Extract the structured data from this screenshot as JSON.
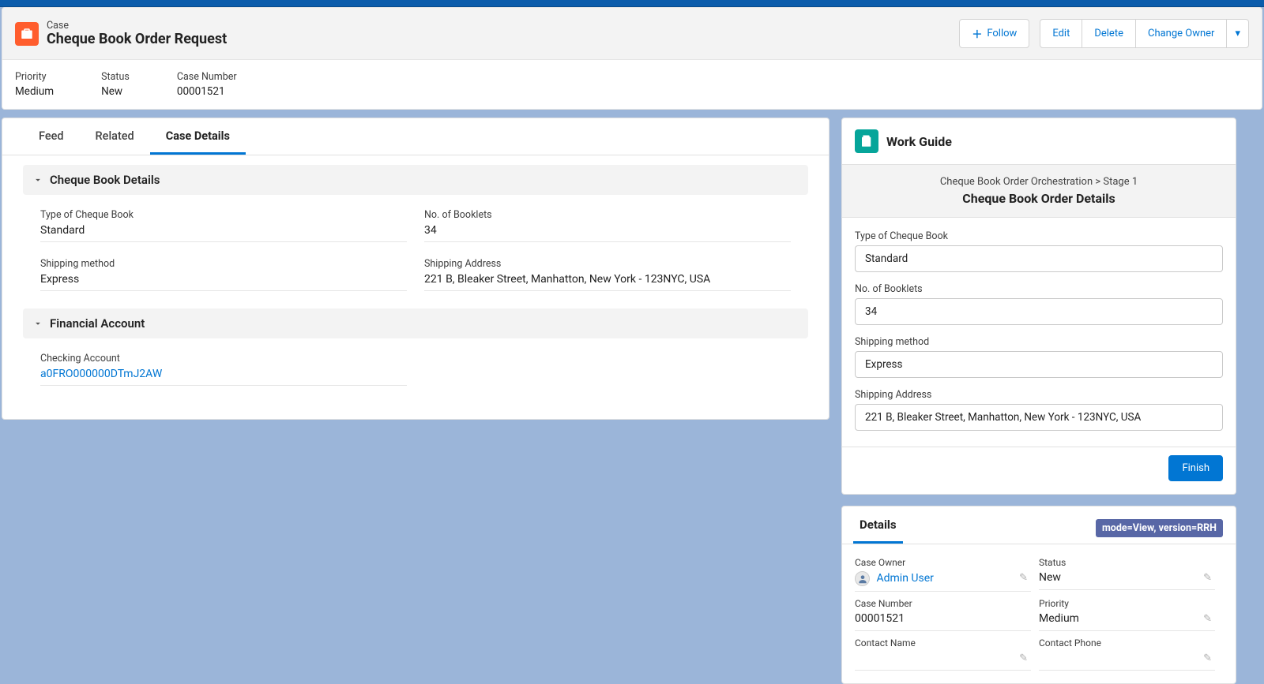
{
  "header": {
    "object_label": "Case",
    "title": "Cheque Book Order Request",
    "actions": {
      "follow": "Follow",
      "edit": "Edit",
      "delete": "Delete",
      "change_owner": "Change Owner"
    }
  },
  "highlights": {
    "priority": {
      "label": "Priority",
      "value": "Medium"
    },
    "status": {
      "label": "Status",
      "value": "New"
    },
    "case_number": {
      "label": "Case Number",
      "value": "00001521"
    }
  },
  "tabs": {
    "feed": "Feed",
    "related": "Related",
    "details": "Case Details"
  },
  "sections": {
    "cheque": {
      "title": "Cheque Book Details",
      "type_of_cheque_book": {
        "label": "Type of Cheque Book",
        "value": "Standard"
      },
      "no_of_booklets": {
        "label": "No. of Booklets",
        "value": "34"
      },
      "shipping_method": {
        "label": "Shipping method",
        "value": "Express"
      },
      "shipping_address": {
        "label": "Shipping Address",
        "value": "221 B, Bleaker Street, Manhatton, New York - 123NYC, USA"
      }
    },
    "financial": {
      "title": "Financial Account",
      "checking_account": {
        "label": "Checking Account",
        "value": "a0FRO000000DTmJ2AW"
      }
    }
  },
  "work_guide": {
    "panel_title": "Work Guide",
    "breadcrumb": "Cheque Book Order Orchestration > Stage 1",
    "stage_title": "Cheque Book Order Details",
    "finish_label": "Finish",
    "fields": {
      "type_of_cheque_book": {
        "label": "Type of Cheque Book",
        "value": "Standard"
      },
      "no_of_booklets": {
        "label": "No. of Booklets",
        "value": "34"
      },
      "shipping_method": {
        "label": "Shipping method",
        "value": "Express"
      },
      "shipping_address": {
        "label": "Shipping Address",
        "value": "221 B, Bleaker Street, Manhatton, New York - 123NYC, USA"
      }
    }
  },
  "details_panel": {
    "tab_label": "Details",
    "mode_chip": "mode=View, version=RRH",
    "case_owner": {
      "label": "Case Owner",
      "value": "Admin User"
    },
    "status": {
      "label": "Status",
      "value": "New"
    },
    "case_number": {
      "label": "Case Number",
      "value": "00001521"
    },
    "priority": {
      "label": "Priority",
      "value": "Medium"
    },
    "contact_name": {
      "label": "Contact Name",
      "value": ""
    },
    "contact_phone": {
      "label": "Contact Phone",
      "value": ""
    }
  }
}
